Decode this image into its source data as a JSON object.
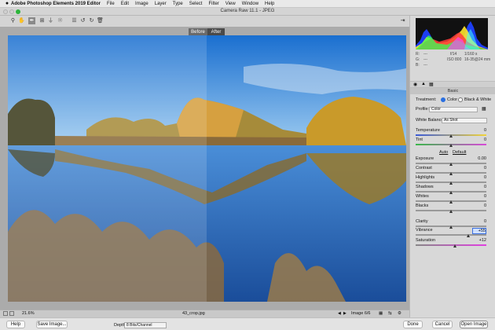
{
  "menubar": {
    "apple": "",
    "items": [
      "Adobe Photoshop Elements 2019 Editor",
      "File",
      "Edit",
      "Image",
      "Layer",
      "Type",
      "Select",
      "Filter",
      "View",
      "Window",
      "Help"
    ]
  },
  "window": {
    "title": "Camera Raw 11.1 - JPEG"
  },
  "toolbar": {
    "tools": [
      "zoom-icon",
      "hand-icon",
      "eyedropper-icon",
      "crop-icon",
      "straighten-icon",
      "redeye-icon",
      "list-icon",
      "rotate-left-icon",
      "rotate-right-icon",
      "trash-icon"
    ],
    "export_icon": "export-icon"
  },
  "preview": {
    "before_label": "Before",
    "after_label": "After"
  },
  "status": {
    "zoom": "21.6%",
    "filename": "43_crop.jpg",
    "image_count": "Image 6/6"
  },
  "histogram": {
    "colors": [
      "#ff3333",
      "#33ff33",
      "#3366ff",
      "#ffee33",
      "#ff44ff",
      "#44ffff"
    ]
  },
  "info": {
    "r_label": "R:",
    "g_label": "G:",
    "b_label": "B:",
    "r": "---",
    "g": "---",
    "b": "---",
    "aperture": "f/14",
    "shutter": "1/160 s",
    "iso": "ISO 800",
    "lens": "16-35@24 mm"
  },
  "panel": {
    "section_title": "Basic",
    "treatment_label": "Treatment:",
    "treatment_color": "Color",
    "treatment_bw": "Black & White",
    "profile_label": "Profile:",
    "profile_value": "Color",
    "wb_label": "White Balance:",
    "wb_value": "As Shot",
    "auto_label": "Auto",
    "default_label": "Default",
    "sliders": [
      {
        "label": "Temperature",
        "value": "0"
      },
      {
        "label": "Tint",
        "value": "0"
      },
      {
        "label": "Exposure",
        "value": "0.00"
      },
      {
        "label": "Contrast",
        "value": "0"
      },
      {
        "label": "Highlights",
        "value": "0"
      },
      {
        "label": "Shadows",
        "value": "0"
      },
      {
        "label": "Whites",
        "value": "0"
      },
      {
        "label": "Blacks",
        "value": "0"
      },
      {
        "label": "Clarity",
        "value": "0"
      },
      {
        "label": "Vibrance",
        "value": "+55"
      },
      {
        "label": "Saturation",
        "value": "+12"
      }
    ]
  },
  "bottom": {
    "help": "Help",
    "save": "Save Image...",
    "depth_label": "Depth:",
    "depth_value": "8 Bits/Channel",
    "done": "Done",
    "cancel": "Cancel",
    "open": "Open Image"
  }
}
